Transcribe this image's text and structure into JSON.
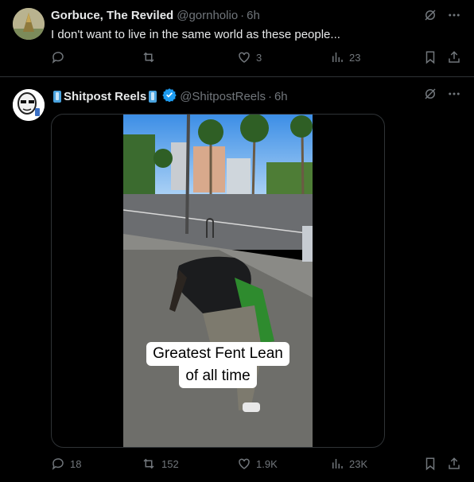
{
  "post1": {
    "display_name": "Gorbuce, The Reviled",
    "handle": "@gornholio",
    "separator": "·",
    "time": "6h",
    "text": "I don't want to live in the same world as these people...",
    "actions": {
      "replies": "",
      "reposts": "",
      "likes": "3",
      "views": "23"
    }
  },
  "post2": {
    "display_name": "Shitpost Reels",
    "handle": "@ShitpostReels",
    "separator": "·",
    "time": "6h",
    "media": {
      "caption_line1": "Greatest Fent Lean",
      "caption_line2": "of all time"
    },
    "actions": {
      "replies": "18",
      "reposts": "152",
      "likes": "1.9K",
      "views": "23K"
    }
  },
  "icons": [
    "grok-icon",
    "more-icon",
    "reply-icon",
    "repost-icon",
    "like-icon",
    "views-icon",
    "bookmark-icon",
    "share-icon",
    "verified-icon",
    "phone-emoji-icon"
  ],
  "colors": {
    "background": "#000000",
    "text": "#e7e9ea",
    "muted": "#71767b",
    "verified": "#1d9bf0",
    "border": "#2f3336"
  }
}
